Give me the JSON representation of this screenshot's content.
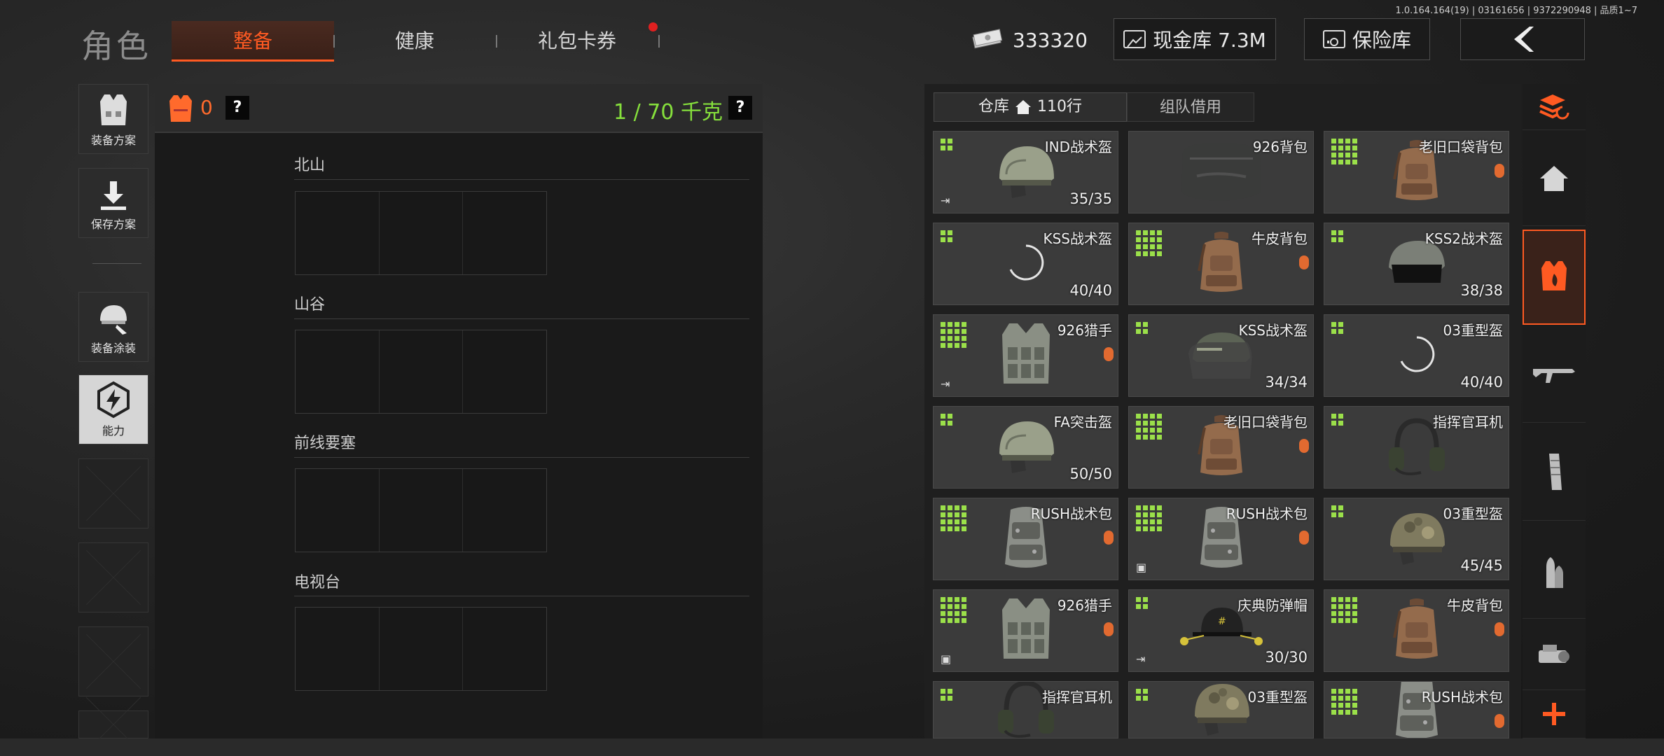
{
  "version_info": "1.0.164.164(19) | 03161656 | 9372290948 | 品质1~7",
  "header": {
    "title": "角色",
    "tabs": [
      {
        "label": "整备"
      },
      {
        "label": "健康"
      },
      {
        "label": "礼包卡券"
      }
    ],
    "money": "333320",
    "cash_vault": "现金库 7.3M",
    "safe_vault": "保险库"
  },
  "left_nav": [
    {
      "label": "装备方案",
      "icon": "vest-icon"
    },
    {
      "label": "保存方案",
      "icon": "download-icon"
    },
    {
      "label": "装备涂装",
      "icon": "helmet-paint-icon"
    },
    {
      "label": "能力",
      "icon": "ability-hex-icon"
    }
  ],
  "loadout": {
    "armor_count": "0",
    "help": "?",
    "weight": "1 / 70 千克"
  },
  "maps": [
    {
      "name": "北山"
    },
    {
      "name": "山谷"
    },
    {
      "name": "前线要塞"
    },
    {
      "name": "电视台"
    }
  ],
  "warehouse": {
    "tab_warehouse": "仓库",
    "rows": "110行",
    "tab_team": "组队借用",
    "items": [
      {
        "name": "IND战术盔",
        "dur": "35/35",
        "grid": 2,
        "type": "helmet",
        "exit": true
      },
      {
        "name": "926背包",
        "dur": "",
        "grid": 0,
        "type": "bag"
      },
      {
        "name": "老旧口袋背包",
        "dur": "",
        "grid": 4,
        "type": "backpack",
        "tag": true
      },
      {
        "name": "KSS战术盔",
        "dur": "40/40",
        "grid": 2,
        "type": "loading"
      },
      {
        "name": "牛皮背包",
        "dur": "",
        "grid": 4,
        "type": "backpack",
        "tag": true
      },
      {
        "name": "KSS2战术盔",
        "dur": "38/38",
        "grid": 2,
        "type": "helmet-black"
      },
      {
        "name": "926猎手",
        "dur": "",
        "grid": 4,
        "type": "vest",
        "tag": true,
        "exit": true
      },
      {
        "name": "KSS战术盔",
        "dur": "34/34",
        "grid": 2,
        "type": "helmet-visor"
      },
      {
        "name": "03重型盔",
        "dur": "40/40",
        "grid": 2,
        "type": "loading"
      },
      {
        "name": "FA突击盔",
        "dur": "50/50",
        "grid": 2,
        "type": "helmet"
      },
      {
        "name": "老旧口袋背包",
        "dur": "",
        "grid": 4,
        "type": "backpack",
        "tag": true
      },
      {
        "name": "指挥官耳机",
        "dur": "",
        "grid": 2,
        "type": "headset"
      },
      {
        "name": "RUSH战术包",
        "dur": "",
        "grid": 4,
        "type": "rush",
        "tag": true
      },
      {
        "name": "RUSH战术包",
        "dur": "",
        "grid": 4,
        "type": "rush",
        "tag": true,
        "box": true
      },
      {
        "name": "03重型盔",
        "dur": "45/45",
        "grid": 2,
        "type": "helmet-camo"
      },
      {
        "name": "926猎手",
        "dur": "",
        "grid": 4,
        "type": "vest",
        "tag": true,
        "box": true
      },
      {
        "name": "庆典防弹帽",
        "dur": "30/30",
        "grid": 2,
        "type": "cap",
        "exit": true
      },
      {
        "name": "牛皮背包",
        "dur": "",
        "grid": 4,
        "type": "backpack",
        "tag": true
      },
      {
        "name": "指挥官耳机",
        "dur": "",
        "grid": 2,
        "type": "headset"
      },
      {
        "name": "03重型盔",
        "dur": "",
        "grid": 2,
        "type": "helmet-camo"
      },
      {
        "name": "RUSH战术包",
        "dur": "",
        "grid": 4,
        "type": "rush",
        "tag": true
      }
    ]
  },
  "right_nav": [
    {
      "icon": "layers-refresh-icon"
    },
    {
      "icon": "home-icon"
    },
    {
      "icon": "vest-fire-icon"
    },
    {
      "icon": "rifle-icon"
    },
    {
      "icon": "magazine-icon"
    },
    {
      "icon": "bullet-icon"
    },
    {
      "icon": "scope-icon"
    },
    {
      "icon": "plus-icon"
    }
  ],
  "colors": {
    "accent": "#ff5a22",
    "green": "#9be04a"
  }
}
